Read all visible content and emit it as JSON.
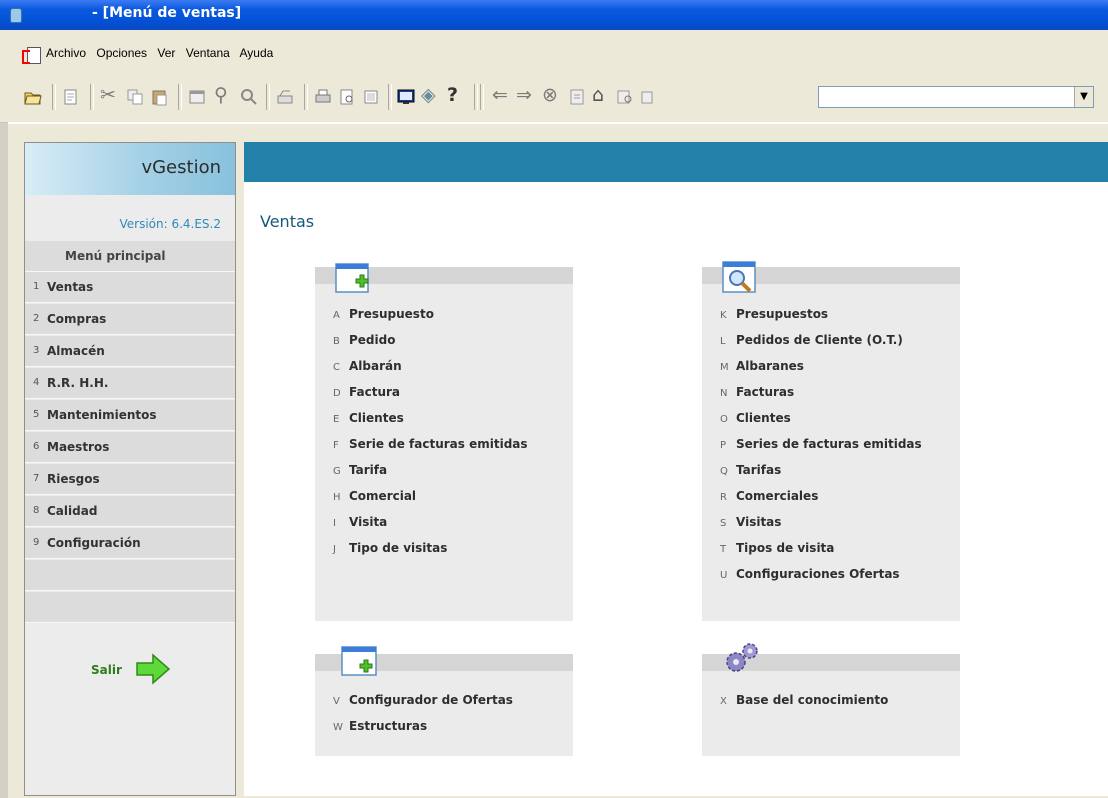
{
  "window": {
    "title": "- [Menú de ventas]"
  },
  "menu": [
    "Archivo",
    "Opciones",
    "Ver",
    "Ventana",
    "Ayuda"
  ],
  "colors": {
    "titlebar": "#0a5ae0",
    "accent_band": "#2380a8",
    "ventas_title": "#145778",
    "version": "#2f8ab8",
    "salir": "#2e7d1b"
  },
  "sidebar": {
    "brand": "vGestion",
    "version": "Versión: 6.4.ES.2",
    "heading": "Menú principal",
    "items": [
      {
        "num": "1",
        "label": "Ventas"
      },
      {
        "num": "2",
        "label": "Compras"
      },
      {
        "num": "3",
        "label": "Almacén"
      },
      {
        "num": "4",
        "label": "R.R. H.H."
      },
      {
        "num": "5",
        "label": "Mantenimientos"
      },
      {
        "num": "6",
        "label": "Maestros"
      },
      {
        "num": "7",
        "label": "Riesgos"
      },
      {
        "num": "8",
        "label": "Calidad"
      },
      {
        "num": "9",
        "label": "Configuración"
      }
    ],
    "exit": "Salir"
  },
  "main": {
    "title": "Ventas",
    "panels": [
      {
        "icon": "new-window-icon",
        "items": [
          {
            "key": "A",
            "label": "Presupuesto"
          },
          {
            "key": "B",
            "label": "Pedido"
          },
          {
            "key": "C",
            "label": "Albarán"
          },
          {
            "key": "D",
            "label": "Factura"
          },
          {
            "key": "E",
            "label": "Clientes"
          },
          {
            "key": "F",
            "label": "Serie de facturas emitidas"
          },
          {
            "key": "G",
            "label": "Tarifa"
          },
          {
            "key": "H",
            "label": "Comercial"
          },
          {
            "key": "I",
            "label": "Visita"
          },
          {
            "key": "J",
            "label": "Tipo de visitas"
          }
        ]
      },
      {
        "icon": "search-window-icon",
        "items": [
          {
            "key": "K",
            "label": "Presupuestos"
          },
          {
            "key": "L",
            "label": "Pedidos de Cliente (O.T.)"
          },
          {
            "key": "M",
            "label": "Albaranes"
          },
          {
            "key": "N",
            "label": "Facturas"
          },
          {
            "key": "O",
            "label": "Clientes"
          },
          {
            "key": "P",
            "label": "Series de facturas emitidas"
          },
          {
            "key": "Q",
            "label": "Tarifas"
          },
          {
            "key": "R",
            "label": "Comerciales"
          },
          {
            "key": "S",
            "label": "Visitas"
          },
          {
            "key": "T",
            "label": "Tipos de visita"
          },
          {
            "key": "U",
            "label": "Configuraciones Ofertas"
          }
        ]
      },
      {
        "icon": "new-window-icon",
        "items": [
          {
            "key": "V",
            "label": "Configurador de Ofertas"
          },
          {
            "key": "W",
            "label": "Estructuras"
          }
        ]
      },
      {
        "icon": "gears-icon",
        "items": [
          {
            "key": "X",
            "label": "Base del conocimiento"
          }
        ]
      }
    ]
  }
}
